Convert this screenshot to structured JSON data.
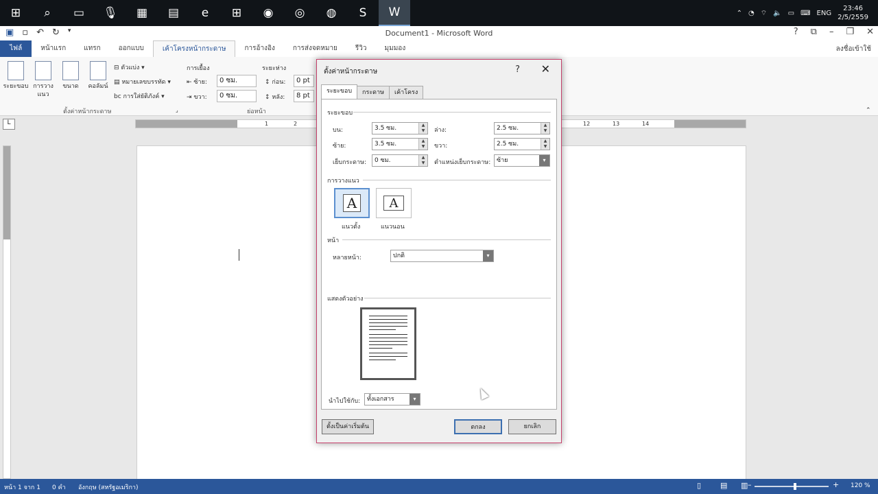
{
  "taskbar": {
    "icons": [
      "windows-logo-icon",
      "search-icon",
      "task-view-icon",
      "microphone-icon",
      "calculator-icon",
      "file-explorer-icon",
      "edge-icon",
      "store-icon",
      "app-icon",
      "chrome-icon",
      "firefox-icon",
      "app-s-icon",
      "word-icon"
    ],
    "tray": {
      "language": "ENG",
      "time": "23:46",
      "date": "2/5/2559"
    }
  },
  "titlebar": {
    "title": "Document1 - Microsoft Word",
    "help": "?"
  },
  "ribbon_tabs": {
    "file": "ไฟล์",
    "items": [
      "หน้าแรก",
      "แทรก",
      "ออกแบบ",
      "เค้าโครงหน้ากระดาษ",
      "การอ้างอิง",
      "การส่งจดหมาย",
      "รีวิว",
      "มุมมอง"
    ],
    "active_index": 3,
    "signin": "ลงชื่อเข้าใช้"
  },
  "ribbon": {
    "margins": "ระยะขอบ",
    "orientation": "การวางแนว",
    "size": "ขนาด",
    "columns": "คอลัมน์",
    "breaks": "ตัวแบ่ง",
    "line_numbers": "หมายเลขบรรทัด",
    "hyphenation": "การใส่ยัติภังค์",
    "page_setup_group": "ตั้งค่าหน้ากระดาษ",
    "indent_label": "การเยื้อง",
    "indent_left_label": "ซ้าย:",
    "indent_left_value": "0 ซม.",
    "indent_right_label": "ขวา:",
    "indent_right_value": "0 ซม.",
    "spacing_label": "ระยะห่าง",
    "spacing_before_label": "ก่อน:",
    "spacing_before_value": "0 pt",
    "spacing_after_label": "หลัง:",
    "spacing_after_value": "8 pt",
    "paragraph_group": "ย่อหน้า"
  },
  "ruler": {
    "ticks_left": [
      "1",
      "2"
    ],
    "ticks_right": [
      "12",
      "13",
      "14"
    ]
  },
  "statusbar": {
    "page": "หน้า 1 จาก 1",
    "words": "0 คำ",
    "language": "อังกฤษ (สหรัฐอเมริกา)",
    "zoom": "120 %",
    "zoom_level": 0.55
  },
  "dialog": {
    "title": "ตั้งค่าหน้ากระดาษ",
    "help": "?",
    "tabs": [
      "ระยะขอบ",
      "กระดาษ",
      "เค้าโครง"
    ],
    "active_tab": 0,
    "margins_section": "ระยะขอบ",
    "top_label": "บน:",
    "top_value": "3.5 ซม.",
    "bottom_label": "ล่าง:",
    "bottom_value": "2.5 ซม.",
    "left_label": "ซ้าย:",
    "left_value": "3.5 ซม.",
    "right_label": "ขวา:",
    "right_value": "2.5 ซม.",
    "gutter_label": "เย็บกระดาษ:",
    "gutter_value": "0 ซม.",
    "gutter_pos_label": "ตำแหน่งเย็บกระดาษ:",
    "gutter_pos_value": "ซ้าย",
    "orientation_section": "การวางแนว",
    "portrait": "แนวตั้ง",
    "landscape": "แนวนอน",
    "glyph": "A",
    "pages_section": "หน้า",
    "multiple_pages_label": "หลายหน้า:",
    "multiple_pages_value": "ปกติ",
    "preview_section": "แสดงตัวอย่าง",
    "apply_to_label": "นำไปใช้กับ:",
    "apply_to_value": "ทั้งเอกสาร",
    "set_default": "ตั้งเป็นค่าเริ่มต้น",
    "ok": "ตกลง",
    "cancel": "ยกเลิก"
  }
}
